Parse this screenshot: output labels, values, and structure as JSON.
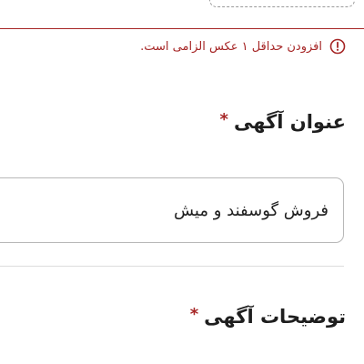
{
  "upload_error": {
    "message": "افزودن حداقل ۱ عکس الزامی است.",
    "icon": "exclamation-circle-icon",
    "color": "#a62626"
  },
  "title_field": {
    "label": "عنوان آگهی",
    "required_mark": "*",
    "value": "فروش گوسفند و میش"
  },
  "description_field": {
    "label": "توضیحات آگهی",
    "required_mark": "*"
  }
}
